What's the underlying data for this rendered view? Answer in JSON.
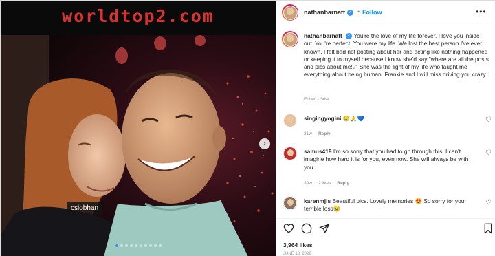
{
  "photo": {
    "watermark": "worldtop2.com",
    "tag_label": "csiobhan",
    "next_arrow": "›",
    "carousel_dots": 10,
    "carousel_active": 0,
    "accent_color": "#3897f0"
  },
  "header": {
    "username": "nathanbarnatt",
    "verified_icon": "verified-badge-icon",
    "separator": "•",
    "follow_label": "Follow",
    "more_icon": "more-options-icon",
    "more_glyph": "•••"
  },
  "caption": {
    "username": "nathanbarnatt",
    "text": "You're the love of my life forever. I love you inside out. You're perfect. You were my life. We lost the best person I've ever known. I felt bad not posting about her and acting like nothing happened or keeping it to myself because I know she'd say \"where are all the posts and pics about me!?\" She was the light of my life who taught me everything about being human. Frankie and I will miss driving you crazy.",
    "meta": "Edited · 56w"
  },
  "comments": [
    {
      "username": "singingyogini",
      "text": "😢🙏💙",
      "time": "21w",
      "likes": "",
      "reply_label": "Reply"
    },
    {
      "username": "samus419",
      "text": "I'm so sorry that you had to go through this. I can't imagine how hard it is for you, even now. She will always be with you.",
      "time": "39w",
      "likes": "2 likes",
      "reply_label": "Reply"
    },
    {
      "username": "karenmjls",
      "text": "Beautiful pics. Lovely memories 😍 So sorry for your terrible loss😢",
      "time": "",
      "likes": "",
      "reply_label": ""
    }
  ],
  "comment_like_icon": "heart-outline-icon",
  "comment_like_glyph": "♡",
  "actions": {
    "like_icon": "heart-icon",
    "comment_icon": "comment-icon",
    "share_icon": "share-icon",
    "save_icon": "bookmark-icon",
    "likes": "3,964 likes",
    "date": "JUNE 18, 2022"
  }
}
